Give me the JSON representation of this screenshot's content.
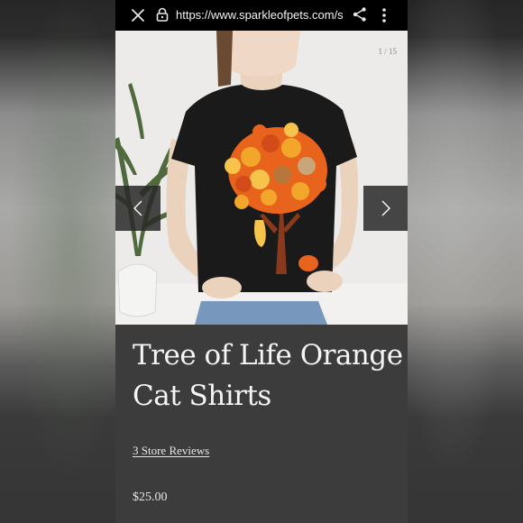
{
  "browser": {
    "url": "https://www.sparkleofpets.com/s",
    "icons": [
      "close-icon",
      "lock-icon",
      "share-icon",
      "more-vert-icon"
    ]
  },
  "gallery": {
    "counter": "1 / 15",
    "icons": [
      "chevron-left-icon",
      "chevron-right-icon"
    ]
  },
  "product": {
    "title": "Tree of Life Orange Cat Shirts",
    "reviews": "3 Store Reviews",
    "price": "$25.00"
  },
  "colors": {
    "url_bar": "#000000",
    "info_panel": "#3c3c3c",
    "shirt": "#1a1a1a",
    "tree_orange": "#e8641c",
    "tree_yellow": "#f2a72a"
  }
}
